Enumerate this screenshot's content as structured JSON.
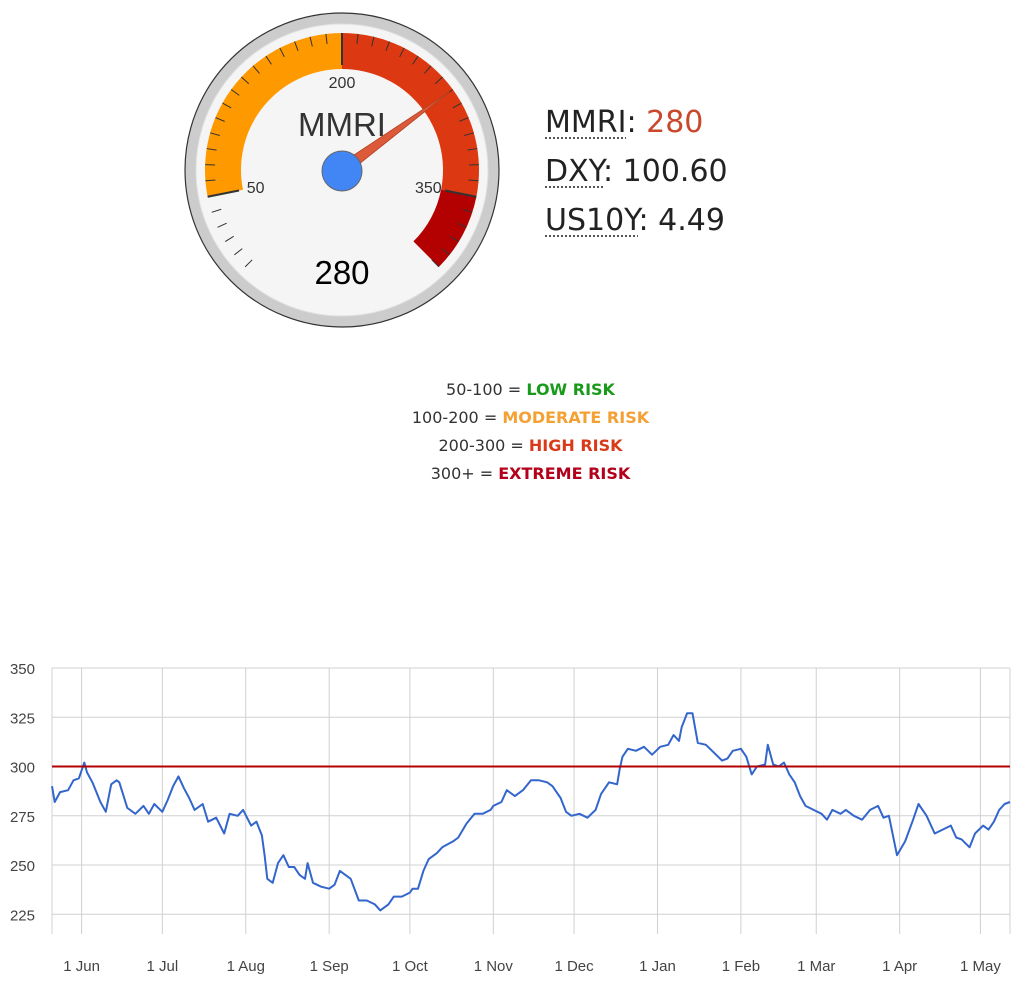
{
  "gauge": {
    "label": "MMRI",
    "value": 280,
    "value_text": "280",
    "min": 0,
    "max": 400,
    "tick_labels": [
      "50",
      "200",
      "350"
    ],
    "bands": [
      {
        "from": 0,
        "to": 50,
        "color": "#f5f5f5"
      },
      {
        "from": 50,
        "to": 200,
        "color": "#ff9900"
      },
      {
        "from": 200,
        "to": 350,
        "color": "#dc3912"
      },
      {
        "from": 350,
        "to": 400,
        "color": "#b30000"
      }
    ],
    "needle_color": "#dc5a3a",
    "hub_color": "#4285f4"
  },
  "readouts": [
    {
      "abbr": "MMRI",
      "value": "280",
      "value_color": "#c9472a"
    },
    {
      "abbr": "DXY",
      "value": "100.60",
      "value_color": "#222222"
    },
    {
      "abbr": "US10Y",
      "value": "4.49",
      "value_color": "#222222"
    }
  ],
  "legend": [
    {
      "range": "50-100 =",
      "level": "LOW RISK",
      "color": "#1a9a1a"
    },
    {
      "range": "100-200 =",
      "level": "MODERATE RISK",
      "color": "#f5a033"
    },
    {
      "range": "200-300 =",
      "level": "HIGH RISK",
      "color": "#d93a1a"
    },
    {
      "range": "300+ =",
      "level": "EXTREME RISK",
      "color": "#b3001b"
    }
  ],
  "chart_data": {
    "type": "line",
    "x_start": "2024-05-21",
    "x_end": "2025-05-12",
    "ylim": [
      215,
      350
    ],
    "yticks": [
      225,
      250,
      275,
      300,
      325,
      350
    ],
    "xticks": [
      {
        "label": "1 Jun",
        "date": "2024-06-01"
      },
      {
        "label": "1 Jul",
        "date": "2024-07-01"
      },
      {
        "label": "1 Aug",
        "date": "2024-08-01"
      },
      {
        "label": "1 Sep",
        "date": "2024-09-01"
      },
      {
        "label": "1 Oct",
        "date": "2024-10-01"
      },
      {
        "label": "1 Nov",
        "date": "2024-11-01"
      },
      {
        "label": "1 Dec",
        "date": "2024-12-01"
      },
      {
        "label": "1 Jan",
        "date": "2025-01-01"
      },
      {
        "label": "1 Feb",
        "date": "2025-02-01"
      },
      {
        "label": "1 Mar",
        "date": "2025-03-01"
      },
      {
        "label": "1 Apr",
        "date": "2025-04-01"
      },
      {
        "label": "1 May",
        "date": "2025-05-01"
      }
    ],
    "threshold": {
      "value": 300,
      "color": "#b30000"
    },
    "grid": true,
    "series": [
      {
        "color": "#3366cc",
        "points": [
          [
            "2024-05-21",
            290
          ],
          [
            "2024-05-22",
            282
          ],
          [
            "2024-05-24",
            287
          ],
          [
            "2024-05-27",
            288
          ],
          [
            "2024-05-29",
            293
          ],
          [
            "2024-05-31",
            294
          ],
          [
            "2024-06-02",
            302
          ],
          [
            "2024-06-03",
            297
          ],
          [
            "2024-06-05",
            292
          ],
          [
            "2024-06-08",
            282
          ],
          [
            "2024-06-10",
            277
          ],
          [
            "2024-06-12",
            291
          ],
          [
            "2024-06-14",
            293
          ],
          [
            "2024-06-15",
            292
          ],
          [
            "2024-06-18",
            279
          ],
          [
            "2024-06-21",
            276
          ],
          [
            "2024-06-24",
            280
          ],
          [
            "2024-06-26",
            276
          ],
          [
            "2024-06-28",
            281
          ],
          [
            "2024-07-01",
            277
          ],
          [
            "2024-07-03",
            283
          ],
          [
            "2024-07-05",
            290
          ],
          [
            "2024-07-07",
            295
          ],
          [
            "2024-07-09",
            289
          ],
          [
            "2024-07-11",
            284
          ],
          [
            "2024-07-13",
            278
          ],
          [
            "2024-07-16",
            281
          ],
          [
            "2024-07-18",
            272
          ],
          [
            "2024-07-21",
            274
          ],
          [
            "2024-07-24",
            266
          ],
          [
            "2024-07-26",
            276
          ],
          [
            "2024-07-29",
            275
          ],
          [
            "2024-07-31",
            278
          ],
          [
            "2024-08-03",
            270
          ],
          [
            "2024-08-05",
            272
          ],
          [
            "2024-08-07",
            265
          ],
          [
            "2024-08-08",
            255
          ],
          [
            "2024-08-09",
            243
          ],
          [
            "2024-08-11",
            241
          ],
          [
            "2024-08-13",
            251
          ],
          [
            "2024-08-15",
            255
          ],
          [
            "2024-08-17",
            249
          ],
          [
            "2024-08-19",
            249
          ],
          [
            "2024-08-21",
            245
          ],
          [
            "2024-08-23",
            243
          ],
          [
            "2024-08-24",
            251
          ],
          [
            "2024-08-26",
            241
          ],
          [
            "2024-08-29",
            239
          ],
          [
            "2024-09-01",
            238
          ],
          [
            "2024-09-03",
            240
          ],
          [
            "2024-09-05",
            247
          ],
          [
            "2024-09-09",
            243
          ],
          [
            "2024-09-12",
            232
          ],
          [
            "2024-09-15",
            232
          ],
          [
            "2024-09-18",
            230
          ],
          [
            "2024-09-20",
            227
          ],
          [
            "2024-09-23",
            230
          ],
          [
            "2024-09-25",
            234
          ],
          [
            "2024-09-28",
            234
          ],
          [
            "2024-10-01",
            236
          ],
          [
            "2024-10-02",
            238
          ],
          [
            "2024-10-04",
            238
          ],
          [
            "2024-10-06",
            247
          ],
          [
            "2024-10-08",
            253
          ],
          [
            "2024-10-11",
            256
          ],
          [
            "2024-10-13",
            259
          ],
          [
            "2024-10-17",
            262
          ],
          [
            "2024-10-19",
            264
          ],
          [
            "2024-10-22",
            271
          ],
          [
            "2024-10-25",
            276
          ],
          [
            "2024-10-28",
            276
          ],
          [
            "2024-10-31",
            278
          ],
          [
            "2024-11-01",
            280
          ],
          [
            "2024-11-04",
            282
          ],
          [
            "2024-11-06",
            288
          ],
          [
            "2024-11-09",
            285
          ],
          [
            "2024-11-12",
            288
          ],
          [
            "2024-11-15",
            293
          ],
          [
            "2024-11-18",
            293
          ],
          [
            "2024-11-21",
            292
          ],
          [
            "2024-11-23",
            290
          ],
          [
            "2024-11-26",
            284
          ],
          [
            "2024-11-28",
            277
          ],
          [
            "2024-11-30",
            275
          ],
          [
            "2024-12-03",
            276
          ],
          [
            "2024-12-06",
            274
          ],
          [
            "2024-12-09",
            278
          ],
          [
            "2024-12-11",
            286
          ],
          [
            "2024-12-14",
            292
          ],
          [
            "2024-12-17",
            291
          ],
          [
            "2024-12-18",
            299
          ],
          [
            "2024-12-19",
            305
          ],
          [
            "2024-12-21",
            309
          ],
          [
            "2024-12-24",
            308
          ],
          [
            "2024-12-27",
            310
          ],
          [
            "2024-12-30",
            306
          ],
          [
            "2025-01-02",
            310
          ],
          [
            "2025-01-05",
            311
          ],
          [
            "2025-01-07",
            316
          ],
          [
            "2025-01-09",
            313
          ],
          [
            "2025-01-10",
            320
          ],
          [
            "2025-01-12",
            327
          ],
          [
            "2025-01-14",
            327
          ],
          [
            "2025-01-16",
            312
          ],
          [
            "2025-01-19",
            311
          ],
          [
            "2025-01-22",
            307
          ],
          [
            "2025-01-25",
            303
          ],
          [
            "2025-01-27",
            304
          ],
          [
            "2025-01-29",
            308
          ],
          [
            "2025-02-01",
            309
          ],
          [
            "2025-02-03",
            305
          ],
          [
            "2025-02-05",
            296
          ],
          [
            "2025-02-07",
            300
          ],
          [
            "2025-02-10",
            301
          ],
          [
            "2025-02-11",
            311
          ],
          [
            "2025-02-13",
            301
          ],
          [
            "2025-02-15",
            300
          ],
          [
            "2025-02-17",
            302
          ],
          [
            "2025-02-19",
            296
          ],
          [
            "2025-02-21",
            292
          ],
          [
            "2025-02-23",
            285
          ],
          [
            "2025-02-25",
            280
          ],
          [
            "2025-02-28",
            278
          ],
          [
            "2025-03-03",
            276
          ],
          [
            "2025-03-05",
            273
          ],
          [
            "2025-03-07",
            278
          ],
          [
            "2025-03-10",
            276
          ],
          [
            "2025-03-12",
            278
          ],
          [
            "2025-03-15",
            275
          ],
          [
            "2025-03-18",
            273
          ],
          [
            "2025-03-21",
            278
          ],
          [
            "2025-03-24",
            280
          ],
          [
            "2025-03-26",
            274
          ],
          [
            "2025-03-28",
            275
          ],
          [
            "2025-03-31",
            255
          ],
          [
            "2025-04-03",
            262
          ],
          [
            "2025-04-06",
            273
          ],
          [
            "2025-04-08",
            281
          ],
          [
            "2025-04-11",
            275
          ],
          [
            "2025-04-14",
            266
          ],
          [
            "2025-04-17",
            268
          ],
          [
            "2025-04-20",
            270
          ],
          [
            "2025-04-22",
            264
          ],
          [
            "2025-04-24",
            263
          ],
          [
            "2025-04-27",
            259
          ],
          [
            "2025-04-29",
            266
          ],
          [
            "2025-05-02",
            270
          ],
          [
            "2025-05-04",
            268
          ],
          [
            "2025-05-06",
            272
          ],
          [
            "2025-05-08",
            278
          ],
          [
            "2025-05-10",
            281
          ],
          [
            "2025-05-12",
            282
          ]
        ]
      }
    ]
  }
}
